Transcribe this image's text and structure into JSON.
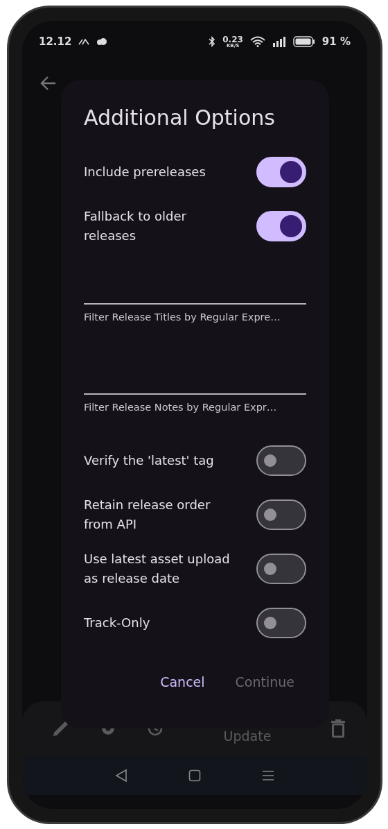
{
  "status_bar": {
    "time": "12.12",
    "net_speed": "0.23",
    "net_unit": "KB/S",
    "battery": "91 %"
  },
  "dialog": {
    "title": "Additional Options",
    "items": [
      {
        "kind": "switch",
        "label": "Include prereleases",
        "on": true
      },
      {
        "kind": "switch",
        "label": "Fallback to older releases",
        "on": true
      },
      {
        "kind": "field",
        "label": "Filter Release Titles by Regular Expre…"
      },
      {
        "kind": "field",
        "label": "Filter Release Notes by Regular Expr…"
      },
      {
        "kind": "switch",
        "label": "Verify the 'latest' tag",
        "on": false
      },
      {
        "kind": "switch",
        "label": "Retain release order from API",
        "on": false
      },
      {
        "kind": "switch",
        "label": "Use latest asset upload as release date",
        "on": false
      },
      {
        "kind": "switch",
        "label": "Track-Only",
        "on": false
      }
    ],
    "buttons": [
      {
        "label": "Cancel",
        "disabled": false
      },
      {
        "label": "Continue",
        "disabled": true
      }
    ]
  },
  "bottom_bar": {
    "update_label": "Update"
  }
}
